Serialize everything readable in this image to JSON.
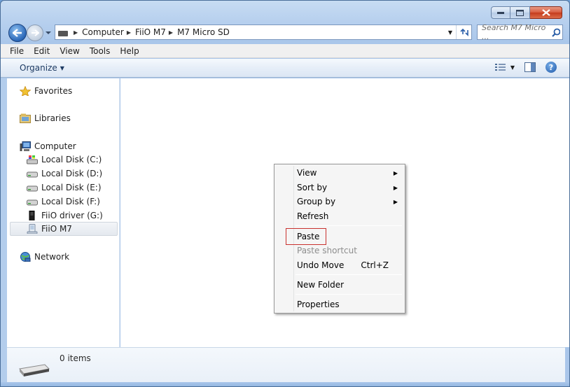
{
  "window": {
    "caption_buttons": {
      "minimize": "minimize",
      "maximize": "maximize",
      "close": "close"
    }
  },
  "address_bar": {
    "crumbs": [
      "Computer",
      "FiiO M7",
      "M7 Micro SD"
    ],
    "search_placeholder": "Search M7 Micro ..."
  },
  "menubar": {
    "items": [
      "File",
      "Edit",
      "View",
      "Tools",
      "Help"
    ]
  },
  "command_bar": {
    "organize_label": "Organize"
  },
  "nav_pane": {
    "favorites": "Favorites",
    "libraries": "Libraries",
    "computer": "Computer",
    "drives": [
      {
        "label": "Local Disk (C:)",
        "icon": "system-drive-icon"
      },
      {
        "label": "Local Disk (D:)",
        "icon": "hard-drive-icon"
      },
      {
        "label": "Local Disk (E:)",
        "icon": "hard-drive-icon"
      },
      {
        "label": "Local Disk (F:)",
        "icon": "hard-drive-icon"
      },
      {
        "label": "FiiO driver (G:)",
        "icon": "device-drive-icon"
      },
      {
        "label": "FiiO M7",
        "icon": "portable-device-icon",
        "selected": true
      }
    ],
    "network": "Network"
  },
  "details_pane": {
    "items_count": "0 items"
  },
  "context_menu": {
    "view": "View",
    "sort_by": "Sort by",
    "group_by": "Group by",
    "refresh": "Refresh",
    "paste": "Paste",
    "paste_shortcut": "Paste shortcut",
    "undo_move": "Undo Move",
    "undo_move_shortcut": "Ctrl+Z",
    "new_folder": "New Folder",
    "properties": "Properties"
  },
  "colors": {
    "frame": "#b7d0ee",
    "highlight_box": "#c9322f",
    "link_blue": "#1e3b63"
  }
}
